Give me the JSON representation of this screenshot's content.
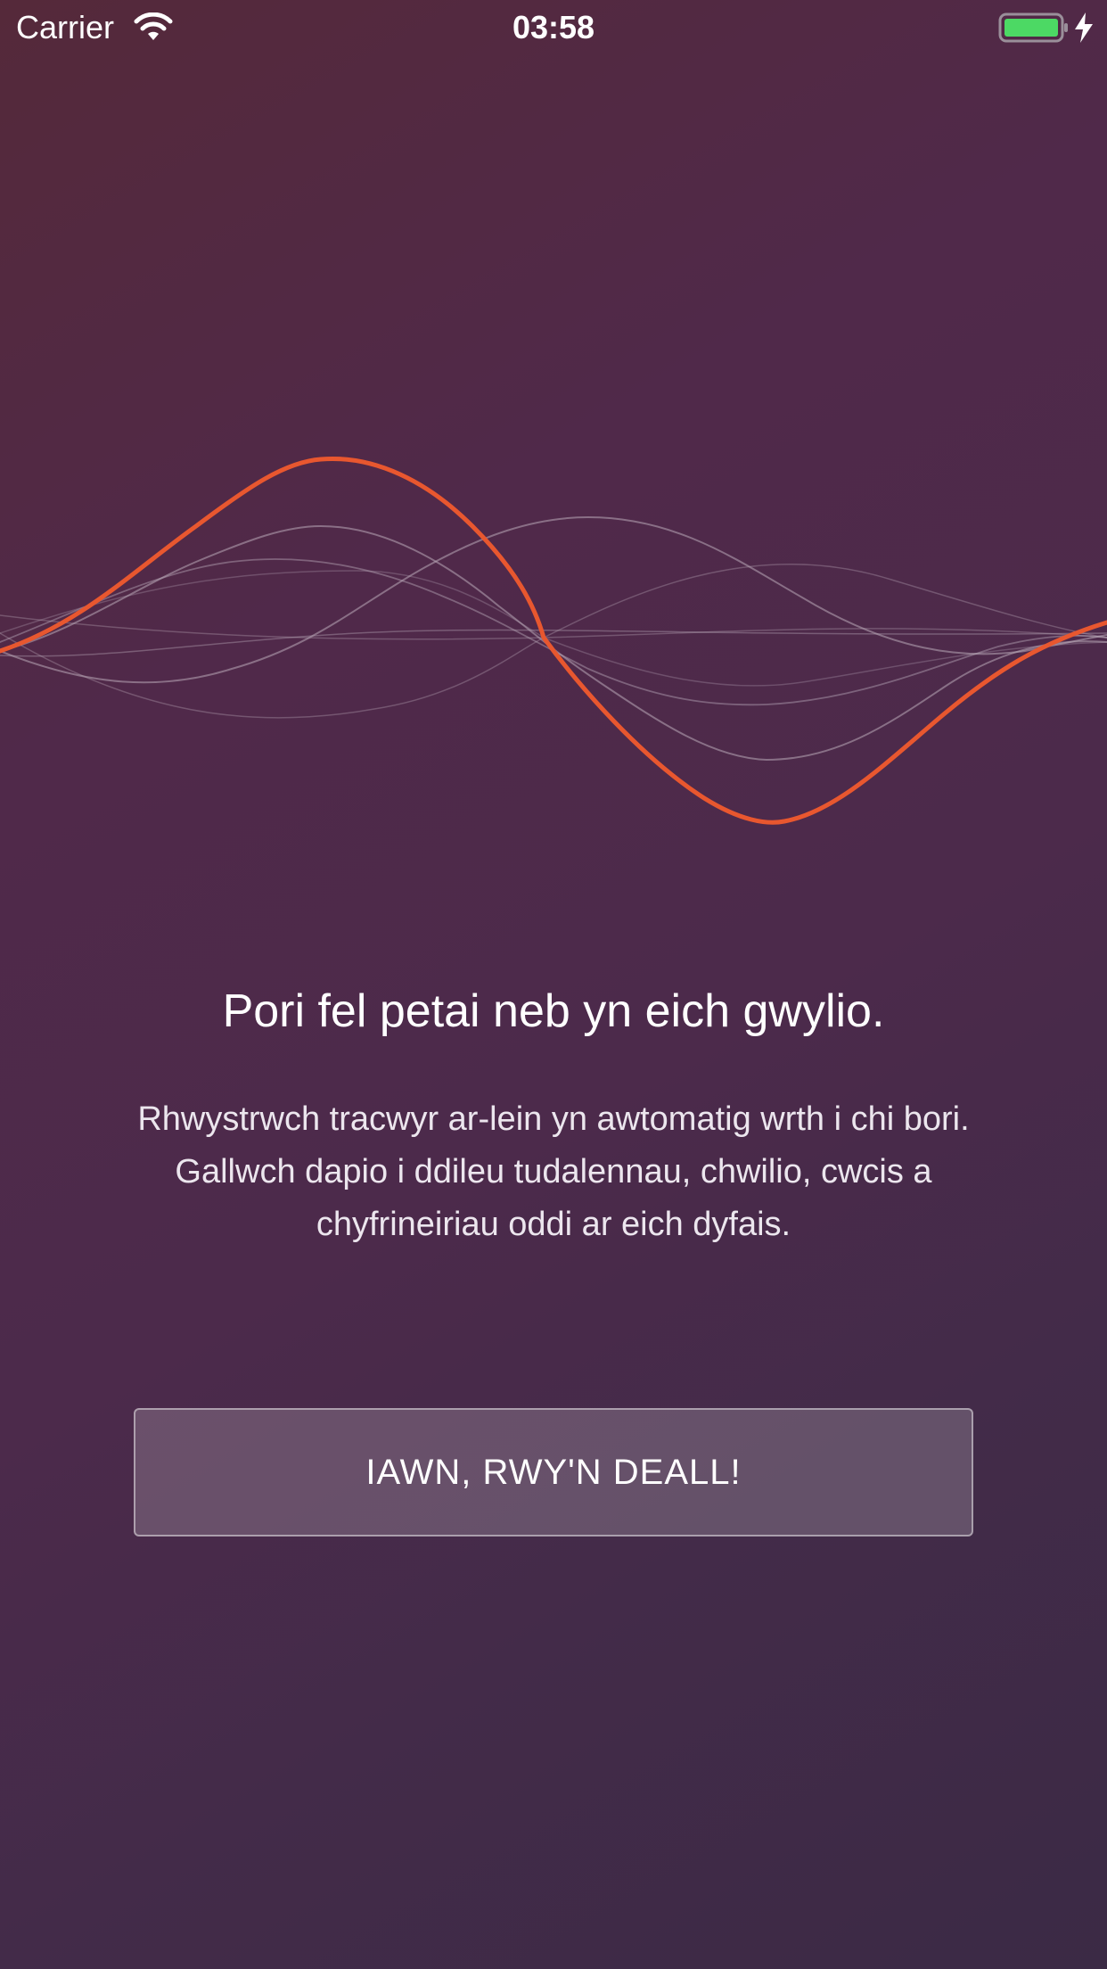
{
  "status_bar": {
    "carrier": "Carrier",
    "time": "03:58",
    "wifi_icon": "wifi-icon",
    "battery_icon": "battery-charging-icon",
    "battery_color": "#4cd964"
  },
  "illustration": {
    "name": "waveform-illustration",
    "accent_color": "#e8572f",
    "line_color": "#b9a9b8"
  },
  "onboarding": {
    "headline": "Pori fel petai neb yn eich gwylio.",
    "body": "Rhwystrwch tracwyr ar-lein yn awtomatig wrth i chi bori. Gallwch dapio i ddileu tudalennau, chwilio, cwcis a chyfrineiriau oddi ar eich dyfais.",
    "button_label": "IAWN, RWY'N DEALL!"
  },
  "colors": {
    "background_start": "#55293a",
    "background_end": "#3b2a45",
    "text": "#ffffff"
  }
}
